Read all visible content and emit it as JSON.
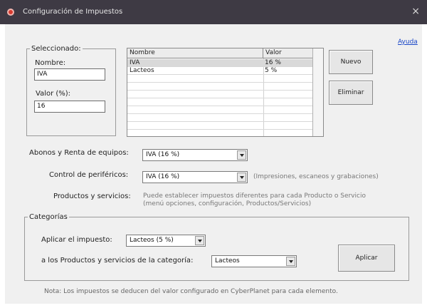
{
  "window": {
    "title": "Configuración de Impuestos",
    "close_glyph": "×"
  },
  "help_link": "Ayuda",
  "selected_group": {
    "legend": "Seleccionado:",
    "name_label": "Nombre:",
    "name_value": "IVA",
    "value_label": "Valor (%):",
    "value_value": "16"
  },
  "taxes_grid": {
    "headers": {
      "name": "Nombre",
      "value": "Valor"
    },
    "rows": [
      {
        "name": "IVA",
        "value": "16 %",
        "selected": true
      },
      {
        "name": "Lacteos",
        "value": "5 %",
        "selected": false
      }
    ]
  },
  "buttons": {
    "nuevo": "Nuevo",
    "eliminar": "Eliminar",
    "aplicar": "Aplicar"
  },
  "abonos": {
    "label": "Abonos y Renta de equipos:",
    "value": "IVA (16 %)"
  },
  "control": {
    "label": "Control de periféricos:",
    "value": "IVA (16 %)",
    "hint": "(Impresiones, escaneos y grabaciones)"
  },
  "productos": {
    "label": "Productos y servicios:",
    "info_line1": "Puede establecer impuestos diferentes para cada Producto o Servicio",
    "info_line2": "(menú opciones, configuración, Productos/Servicios)"
  },
  "categorias": {
    "legend": "Categorías",
    "apply_tax_label": "Aplicar el impuesto:",
    "apply_tax_value": "Lacteos (5 %)",
    "category_label": "a los Productos y servicios de la categoría:",
    "category_value": "Lacteos"
  },
  "note": "Nota: Los impuestos se deducen del valor configurado en CyberPlanet para cada elemento.",
  "colors": {
    "titlebar": "#3e3a44",
    "link": "#1a47c8",
    "app_icon": "#d83a2f"
  }
}
